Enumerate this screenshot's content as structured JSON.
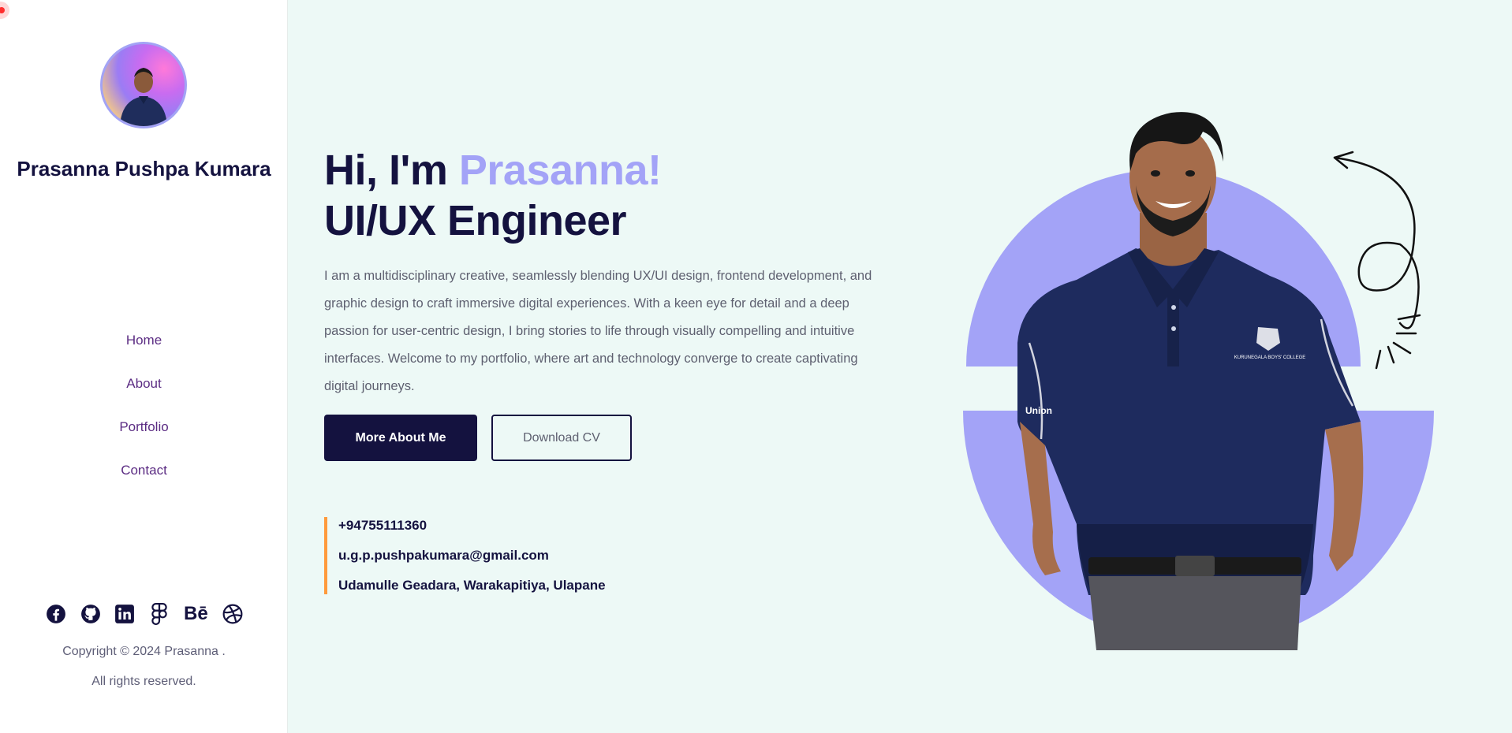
{
  "sidebar": {
    "name": "Prasanna Pushpa Kumara",
    "nav": [
      {
        "label": "Home"
      },
      {
        "label": "About"
      },
      {
        "label": "Portfolio"
      },
      {
        "label": "Contact"
      }
    ],
    "socials": [
      {
        "icon": "facebook-icon"
      },
      {
        "icon": "github-icon"
      },
      {
        "icon": "linkedin-icon"
      },
      {
        "icon": "figma-icon"
      },
      {
        "icon": "behance-icon",
        "text": "Bē"
      },
      {
        "icon": "dribbble-icon"
      }
    ],
    "copyright": "Copyright © 2024 Prasanna .",
    "rights": "All rights reserved."
  },
  "hero": {
    "greeting": "Hi, I'm ",
    "name": "Prasanna!",
    "role": "UI/UX Engineer",
    "intro": "I am a multidisciplinary creative, seamlessly blending UX/UI design, frontend development, and graphic design to craft immersive digital experiences. With a keen eye for detail and a deep passion for user-centric design, I bring stories to life through visually compelling and intuitive interfaces. Welcome to my portfolio, where art and technology converge to create captivating digital journeys.",
    "primary_button": "More About Me",
    "secondary_button": "Download CV"
  },
  "contact": {
    "phone": "+94755111360",
    "email": "u.g.p.pushpakumara@gmail.com",
    "address": "Udamulle Geadara, Warakapitiya, Ulapane"
  },
  "portrait": {
    "shirt_text": "Union",
    "crest_text": "KURUNEGALA BOYS' COLLEGE"
  },
  "colors": {
    "primary": "#14123f",
    "accent": "#a3a3f7",
    "background": "#edf9f6",
    "contact_border": "#ff9a3c",
    "nav_text": "#5b2c83"
  }
}
